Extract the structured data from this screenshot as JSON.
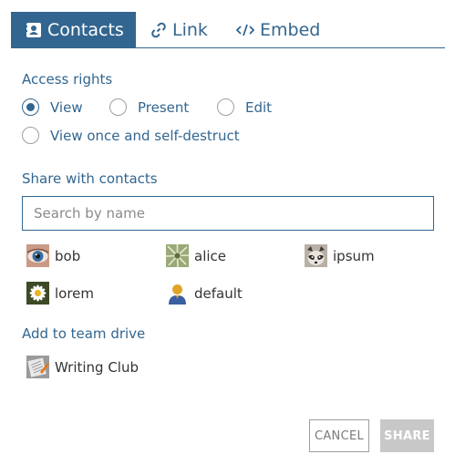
{
  "tabs": [
    {
      "label": "Contacts",
      "icon": "contact-card-icon",
      "active": true
    },
    {
      "label": "Link",
      "icon": "link-icon",
      "active": false
    },
    {
      "label": "Embed",
      "icon": "code-icon",
      "active": false
    }
  ],
  "access": {
    "title": "Access rights",
    "options": [
      {
        "label": "View",
        "checked": true
      },
      {
        "label": "Present",
        "checked": false
      },
      {
        "label": "Edit",
        "checked": false
      },
      {
        "label": "View once and self-destruct",
        "checked": false
      }
    ]
  },
  "share": {
    "title": "Share with contacts",
    "search_placeholder": "Search by name",
    "contacts": [
      {
        "name": "bob",
        "avatar": "eye-photo"
      },
      {
        "name": "alice",
        "avatar": "plant-photo"
      },
      {
        "name": "ipsum",
        "avatar": "raccoon-photo"
      },
      {
        "name": "lorem",
        "avatar": "daisy-photo"
      },
      {
        "name": "default",
        "avatar": "default-user-icon"
      }
    ]
  },
  "team": {
    "title": "Add to team drive",
    "drives": [
      {
        "name": "Writing Club",
        "avatar": "notebook-photo"
      }
    ]
  },
  "actions": {
    "cancel_label": "CANCEL",
    "share_label": "SHARE"
  },
  "colors": {
    "accent": "#326690",
    "disabled_button": "#c8c8c8"
  }
}
